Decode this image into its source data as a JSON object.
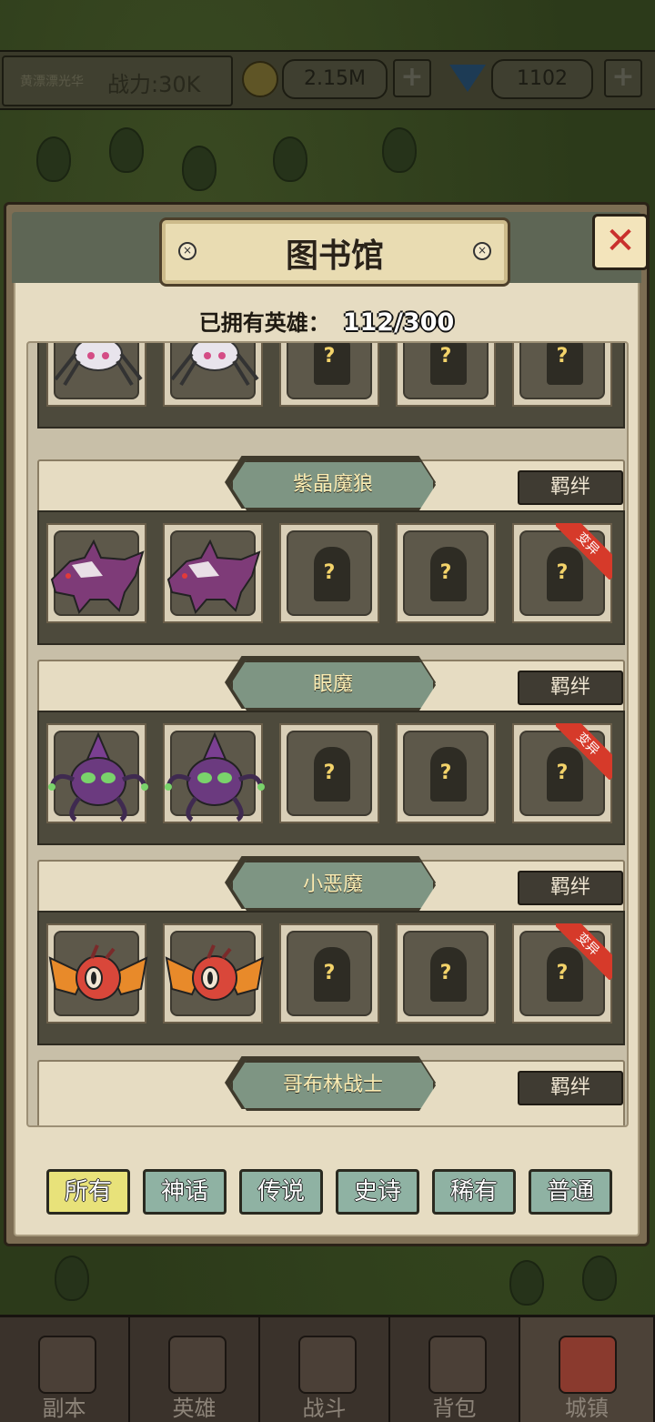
{
  "hud": {
    "player_name": "黄漂漂光华",
    "power": "战力:30K",
    "gold": "2.15M",
    "gems": "1102",
    "plus": "+"
  },
  "library": {
    "title": "图书馆",
    "close": "✕",
    "owned_label": "已拥有英雄：",
    "owned_count": "112/300",
    "bond_label": "羁绊",
    "mutation_tag": "变异",
    "unknown_mark": "?",
    "groups": [
      {
        "name": "紫晶魔狼",
        "monster": "wolf"
      },
      {
        "name": "眼魔",
        "monster": "beholder"
      },
      {
        "name": "小恶魔",
        "monster": "imp"
      },
      {
        "name": "哥布林战士",
        "monster": "goblin"
      }
    ],
    "filters": [
      {
        "label": "所有",
        "active": true
      },
      {
        "label": "神话",
        "active": false
      },
      {
        "label": "传说",
        "active": false
      },
      {
        "label": "史诗",
        "active": false
      },
      {
        "label": "稀有",
        "active": false
      },
      {
        "label": "普通",
        "active": false
      }
    ]
  },
  "nav": [
    {
      "label": "副本",
      "icon": "map-icon"
    },
    {
      "label": "英雄",
      "icon": "helmet-icon"
    },
    {
      "label": "战斗",
      "icon": "swords-icon"
    },
    {
      "label": "背包",
      "icon": "backpack-icon"
    },
    {
      "label": "城镇",
      "icon": "town-icon",
      "active": true
    }
  ]
}
